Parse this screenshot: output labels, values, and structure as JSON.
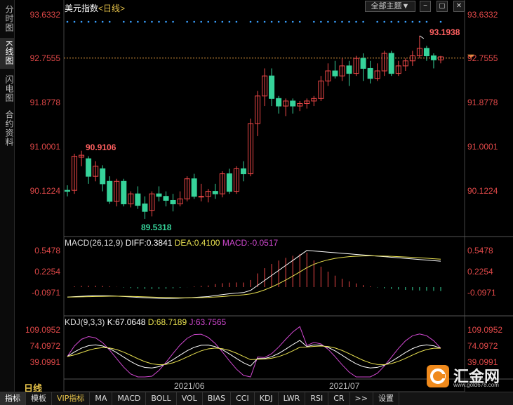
{
  "left_tabs": [
    {
      "label": "分时图",
      "active": false
    },
    {
      "label": "K线图",
      "active": true
    },
    {
      "label": "闪电图",
      "active": false
    },
    {
      "label": "合约资料",
      "active": false
    }
  ],
  "header": {
    "name": "美元指数",
    "period": "<日线>",
    "topic_button": "全部主题▼"
  },
  "price_axis": [
    "93.6332",
    "92.7555",
    "91.8778",
    "91.0001",
    "90.1224"
  ],
  "annotations": {
    "high": "93.1938",
    "low": "89.5318",
    "local_high": "90.9106"
  },
  "macd": {
    "params": "MACD(26,12,9)",
    "diff": "DIFF:0.3841",
    "dea": "DEA:0.4100",
    "macd": "MACD:-0.0517",
    "axis": [
      "0.5478",
      "0.2254",
      "-0.0971"
    ]
  },
  "kdj": {
    "params": "KDJ(9,3,3)",
    "k": "K:67.0648",
    "d": "D:68.7189",
    "j": "J:63.7565",
    "axis": [
      "109.0952",
      "74.0972",
      "39.0991"
    ]
  },
  "period_label": "日线",
  "x_dates": [
    "2021/06",
    "2021/07"
  ],
  "bottom_tabs": [
    "指标",
    "模板",
    "VIP指标",
    "MA",
    "MACD",
    "BOLL",
    "VOL",
    "BIAS",
    "CCI",
    "KDJ",
    "LWR",
    "RSI",
    "CR",
    ">>",
    "设置"
  ],
  "logo": {
    "name": "汇金网",
    "url": "www.gold678.com"
  },
  "colors": {
    "up": "#f04848",
    "down": "#36d39a",
    "diff": "#ffffff",
    "dea": "#e8e050",
    "macd": "#d048d0",
    "k": "#ffffff",
    "d": "#e8e050",
    "j": "#d048d0",
    "dots": "#3aa0ff"
  },
  "candles": [
    [
      90.12,
      90.1,
      90.22,
      90.0
    ],
    [
      90.12,
      90.8,
      90.85,
      90.05
    ],
    [
      90.78,
      90.82,
      90.91,
      90.6
    ],
    [
      90.75,
      90.4,
      90.8,
      90.25
    ],
    [
      90.4,
      90.6,
      90.7,
      90.3
    ],
    [
      90.55,
      90.25,
      90.62,
      90.1
    ],
    [
      90.3,
      89.9,
      90.4,
      89.85
    ],
    [
      89.9,
      90.3,
      90.35,
      89.8
    ],
    [
      90.3,
      89.85,
      90.35,
      89.8
    ],
    [
      89.85,
      90.05,
      90.1,
      89.78
    ],
    [
      90.05,
      89.82,
      90.2,
      89.75
    ],
    [
      89.85,
      89.7,
      90.0,
      89.55
    ],
    [
      89.72,
      90.05,
      90.1,
      89.6
    ],
    [
      90.05,
      90.0,
      90.2,
      89.9
    ],
    [
      90.0,
      89.92,
      90.1,
      89.8
    ],
    [
      89.92,
      89.85,
      90.05,
      89.7
    ],
    [
      89.85,
      89.95,
      90.1,
      89.8
    ],
    [
      89.95,
      90.35,
      90.4,
      89.9
    ],
    [
      90.35,
      90.0,
      90.45,
      89.95
    ],
    [
      90.0,
      90.0,
      90.25,
      89.9
    ],
    [
      90.0,
      90.1,
      90.15,
      89.88
    ],
    [
      90.1,
      90.05,
      90.25,
      89.95
    ],
    [
      90.05,
      90.45,
      90.5,
      89.98
    ],
    [
      90.45,
      90.1,
      90.55,
      90.05
    ],
    [
      90.1,
      90.55,
      90.6,
      90.05
    ],
    [
      90.55,
      90.45,
      90.7,
      90.3
    ],
    [
      90.45,
      91.45,
      91.55,
      90.4
    ],
    [
      91.45,
      92.0,
      92.1,
      91.2
    ],
    [
      92.0,
      92.4,
      92.55,
      91.8
    ],
    [
      92.4,
      91.95,
      92.55,
      91.8
    ],
    [
      91.95,
      91.8,
      92.0,
      91.65
    ],
    [
      91.8,
      91.9,
      91.95,
      91.6
    ],
    [
      91.9,
      91.8,
      91.95,
      91.65
    ],
    [
      91.8,
      91.85,
      91.9,
      91.7
    ],
    [
      91.85,
      91.9,
      91.95,
      91.75
    ],
    [
      91.9,
      91.95,
      92.0,
      91.8
    ],
    [
      91.95,
      92.3,
      92.4,
      91.9
    ],
    [
      92.3,
      92.5,
      92.65,
      92.2
    ],
    [
      92.5,
      92.4,
      92.7,
      92.35
    ],
    [
      92.4,
      92.6,
      92.75,
      92.3
    ],
    [
      92.6,
      92.45,
      92.7,
      92.2
    ],
    [
      92.45,
      92.75,
      92.8,
      92.4
    ],
    [
      92.75,
      92.55,
      92.85,
      92.3
    ],
    [
      92.55,
      92.35,
      92.7,
      92.25
    ],
    [
      92.35,
      92.5,
      92.65,
      92.3
    ],
    [
      92.5,
      92.85,
      92.9,
      92.4
    ],
    [
      92.85,
      92.45,
      92.9,
      92.4
    ],
    [
      92.45,
      92.6,
      92.7,
      92.4
    ],
    [
      92.6,
      92.7,
      92.75,
      92.5
    ],
    [
      92.7,
      92.8,
      92.9,
      92.6
    ],
    [
      92.8,
      92.95,
      93.2,
      92.75
    ],
    [
      92.95,
      92.8,
      93.0,
      92.7
    ],
    [
      92.8,
      92.72,
      92.85,
      92.55
    ],
    [
      92.72,
      92.78,
      92.8,
      92.65
    ]
  ]
}
